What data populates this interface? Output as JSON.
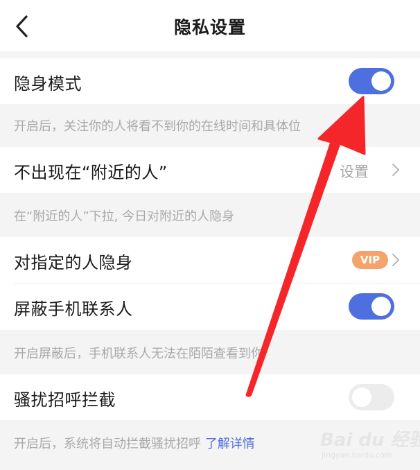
{
  "header": {
    "title": "隐私设置",
    "back_icon": "chevron-left-icon"
  },
  "settings": {
    "stealth_mode": {
      "label": "隐身模式",
      "enabled": true,
      "hint": "开启后，关注你的人将看不到你的在线时间和具体位"
    },
    "hide_nearby": {
      "label": "不出现在“附近的人”",
      "value": "设置",
      "hint": "在“附近的人”下拉, 今日对附近的人隐身"
    },
    "hide_from_specific": {
      "label": "对指定的人隐身",
      "badge": "VIP"
    },
    "block_contacts": {
      "label": "屏蔽手机联系人",
      "enabled": true,
      "hint": "开启屏蔽后，手机联系人无法在陌陌查看到你"
    },
    "harassment_block": {
      "label": "骚扰招呼拦截",
      "enabled": false,
      "hint": "开启后，系统将自动拦截骚扰招呼",
      "link": "了解详情"
    }
  },
  "watermark": {
    "brand": "Bai du 经验",
    "url": "jingyan.baidu.com"
  },
  "colors": {
    "toggle_on": "#4d6fe0",
    "toggle_off": "#ececec",
    "vip_badge": "#f5a36b",
    "annotation_arrow": "#f5262a",
    "link": "#4d6fe0"
  }
}
